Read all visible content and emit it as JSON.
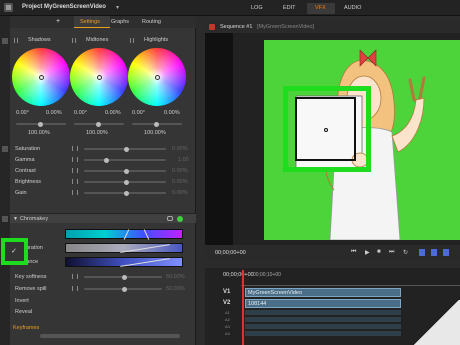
{
  "app": {
    "title": "Project MyGreenScreenVideo",
    "title_suffix": "▾"
  },
  "modes": [
    {
      "label": "LOG",
      "active": false
    },
    {
      "label": "EDIT",
      "active": false
    },
    {
      "label": "VFX",
      "active": true
    },
    {
      "label": "AUDIO",
      "active": false
    }
  ],
  "left_tabs": {
    "add": "+",
    "items": [
      {
        "label": "Settings",
        "active": true
      },
      {
        "label": "Graphs",
        "active": false
      },
      {
        "label": "Routing",
        "active": false
      }
    ]
  },
  "wheels": [
    {
      "label": "Shadows",
      "a": "0.00°",
      "b": "0.00%",
      "pct": "100.00%"
    },
    {
      "label": "Midtones",
      "a": "0.00°",
      "b": "0.00%",
      "pct": "100.00%"
    },
    {
      "label": "Highlights",
      "a": "0.00°",
      "b": "0.00%",
      "pct": "100.00%"
    }
  ],
  "adjustments": [
    {
      "label": "Saturation",
      "value": "0.00%"
    },
    {
      "label": "Gamma",
      "value": "1.00"
    },
    {
      "label": "Contrast",
      "value": "0.00%"
    },
    {
      "label": "Brightness",
      "value": "0.00%"
    },
    {
      "label": "Gain",
      "value": "0.00%"
    }
  ],
  "chromakey": {
    "header": "Chromakey",
    "check": "✓",
    "rows": [
      {
        "label": "uration",
        "label_left": ""
      },
      {
        "label": "inance",
        "label_left": ""
      }
    ],
    "settings": [
      {
        "label": "Key softness",
        "value": "50.00%"
      },
      {
        "label": "Remove spill",
        "value": "50.00%"
      },
      {
        "label": "Invert",
        "value": ""
      },
      {
        "label": "Reveal",
        "value": ""
      }
    ]
  },
  "keyframes_label": "Keyframes",
  "viewer": {
    "sequence": "Sequence #1",
    "source": "[MyGreenScreenVideo]",
    "timecode": "00;00;00+00"
  },
  "timeline": {
    "timecode": "00;00;00+00",
    "ruler_mark": "00;00;10+00",
    "tracks": [
      {
        "name": "V1",
        "clip": "MyGreenScreenVideo"
      },
      {
        "name": "V2",
        "clip": "108144"
      }
    ],
    "audio_tracks": [
      "A1",
      "A2",
      "A3",
      "A4"
    ]
  },
  "colors": {
    "green_screen": "#4cd43a",
    "highlight": "#1fdc1f",
    "accent": "#e8a020",
    "vfx": "#ff7a00"
  }
}
